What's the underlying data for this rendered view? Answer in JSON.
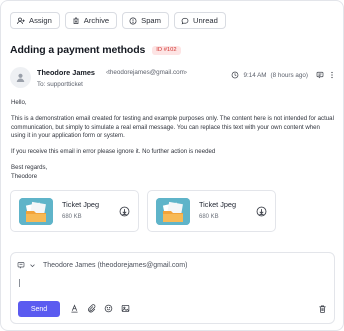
{
  "toolbar": {
    "assign_label": "Assign",
    "archive_label": "Archive",
    "spam_label": "Spam",
    "unread_label": "Unread"
  },
  "ticket": {
    "title": "Adding a payment methods",
    "id_badge": "ID #102"
  },
  "message": {
    "sender_name": "Theodore James",
    "sender_email": "‹theodorejames@gmail.com›",
    "to": "To: supportticket",
    "time": "9:14 AM",
    "ago": "(8 hours ago)",
    "greeting": "Hello,",
    "paragraph1": "This is a demonstration email created for testing and example purposes only. The content here is not intended for actual communication, but simply to simulate a real email message. You can replace this text with your own content when using it in your application form or system.",
    "paragraph2": "If you receive this email in error please ignore it. No further action is needed",
    "signoff": "Best regards,",
    "signature": "Theodore"
  },
  "attachments": [
    {
      "name": "Ticket Jpeg",
      "size": "680 KB"
    },
    {
      "name": "Ticket Jpeg",
      "size": "680 KB"
    }
  ],
  "reply": {
    "recipient": "Theodore James (theodorejames@gmail.com)",
    "send_label": "Send"
  },
  "colors": {
    "accent": "#5b5bf0",
    "badge_bg": "#fde4e4",
    "badge_text": "#d0312d",
    "thumb_bg": "#5fb4c9"
  },
  "icons": [
    "assign-icon",
    "archive-icon",
    "spam-icon",
    "unread-icon",
    "user-icon",
    "clock-icon",
    "reply-icon",
    "more-icon",
    "download-icon",
    "mail-icon",
    "chevron-down-icon",
    "text-format-icon",
    "attach-icon",
    "emoji-icon",
    "image-icon",
    "trash-icon"
  ]
}
